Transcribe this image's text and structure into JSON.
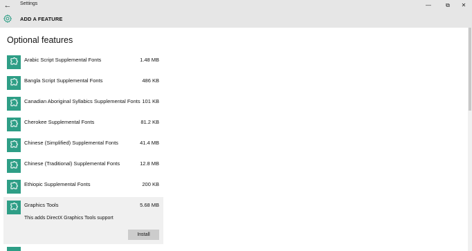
{
  "window": {
    "title": "Settings",
    "back_glyph": "←",
    "minimize_glyph": "—",
    "maximize_glyph": "⧉",
    "close_glyph": "✕"
  },
  "header": {
    "title": "ADD A FEATURE",
    "icon": "gear-icon"
  },
  "main": {
    "section_title": "Optional features",
    "accent_color": "#2e9e86",
    "features": [
      {
        "name": "Arabic Script Supplemental Fonts",
        "size": "1.48 MB"
      },
      {
        "name": "Bangla Script Supplemental Fonts",
        "size": "486 KB"
      },
      {
        "name": "Canadian Aboriginal Syllabics Supplemental Fonts",
        "size": "101 KB"
      },
      {
        "name": "Cherokee Supplemental Fonts",
        "size": "81.2 KB"
      },
      {
        "name": "Chinese (Simplified) Supplemental Fonts",
        "size": "41.4 MB"
      },
      {
        "name": "Chinese (Traditional) Supplemental Fonts",
        "size": "12.8 MB"
      },
      {
        "name": "Ethiopic Supplemental Fonts",
        "size": "200 KB"
      }
    ],
    "selected_feature": {
      "name": "Graphics Tools",
      "size": "5.68 MB",
      "description": "This adds DirectX Graphics Tools support",
      "install_label": "Install"
    }
  }
}
